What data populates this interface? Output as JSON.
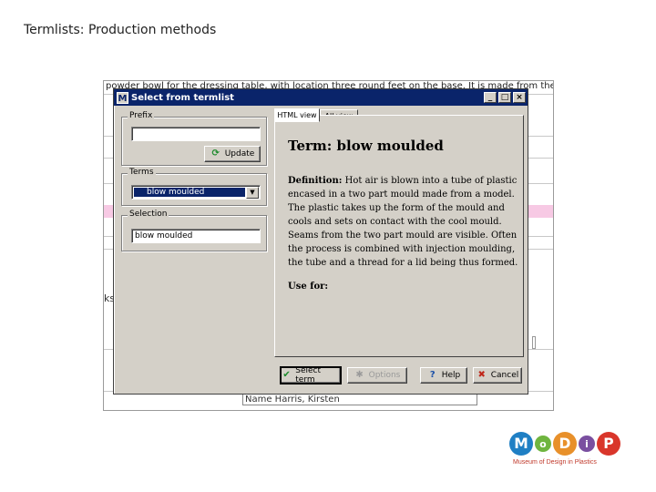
{
  "slide": {
    "title": "Termlists: Production methods"
  },
  "background": {
    "top_text": "powder bowl for the dressing table, with location three round feet on the base. It is made from thermofo",
    "side_text": "ks",
    "name_field": "Name  Harris, Kirsten"
  },
  "dialog": {
    "title": "Select from termlist",
    "icon_letter": "M",
    "prefix": {
      "label": "Prefix",
      "value": "",
      "update_label": "Update"
    },
    "terms": {
      "label": "Terms",
      "selected": "blow moulded"
    },
    "selection": {
      "label": "Selection",
      "value": "blow moulded"
    },
    "tabs": [
      {
        "label": "HTML view"
      },
      {
        "label": "All view"
      }
    ],
    "content": {
      "term_heading": "Term: blow moulded",
      "definition_label": "Definition:",
      "definition_text": "Hot air is blown into a tube of plastic encased in a two part mould made from a model. The plastic takes up the form of the mould and cools and sets on contact with the cool mould. Seams from the two part mould are visible. Often the process is combined with injection moulding, the tube and a thread for a lid being thus formed.",
      "use_for": "Use for:"
    },
    "buttons": {
      "select": "Select term",
      "options": "Options",
      "help": "Help",
      "cancel": "Cancel"
    }
  },
  "logo": {
    "letters": [
      "M",
      "o",
      "D",
      "i",
      "P"
    ],
    "colors": [
      "#1f7fc4",
      "#6fb53f",
      "#e8902a",
      "#7a4fa0",
      "#d9362b"
    ],
    "tagline": "Museum of Design in Plastics"
  }
}
